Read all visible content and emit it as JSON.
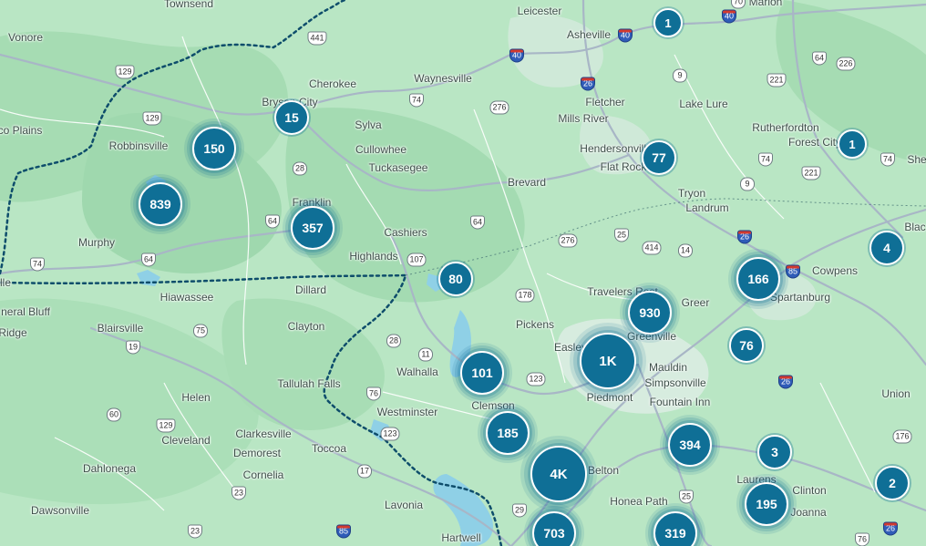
{
  "colors": {
    "land": "#b9e6c4",
    "forest": "#a3dcb2",
    "water": "#8fd0e6",
    "road_major": "#9aa7b5",
    "road_minor": "#ffffff",
    "state_border": "#0e4d6b",
    "cluster": "#0f6f96"
  },
  "places": [
    {
      "id": "townsend",
      "name": "Townsend"
    },
    {
      "id": "vonore",
      "name": "Vonore"
    },
    {
      "id": "leicester",
      "name": "Leicester"
    },
    {
      "id": "asheville",
      "name": "Asheville"
    },
    {
      "id": "marion",
      "name": "Marion"
    },
    {
      "id": "cherokee",
      "name": "Cherokee"
    },
    {
      "id": "waynesville",
      "name": "Waynesville"
    },
    {
      "id": "tellico-plains",
      "name": "co Plains"
    },
    {
      "id": "bryson-city",
      "name": "Bryson City"
    },
    {
      "id": "sylva",
      "name": "Sylva"
    },
    {
      "id": "fletcher",
      "name": "Fletcher"
    },
    {
      "id": "mills-river",
      "name": "Mills River"
    },
    {
      "id": "lake-lure",
      "name": "Lake Lure"
    },
    {
      "id": "rutherfordton",
      "name": "Rutherfordton"
    },
    {
      "id": "robbinsville",
      "name": "Robbinsville"
    },
    {
      "id": "cullowhee",
      "name": "Cullowhee"
    },
    {
      "id": "tuckasegee",
      "name": "Tuckasegee"
    },
    {
      "id": "hendersonville",
      "name": "Hendersonville"
    },
    {
      "id": "flat-rock",
      "name": "Flat Rock"
    },
    {
      "id": "forest-city",
      "name": "Forest City"
    },
    {
      "id": "shelby",
      "name": "She"
    },
    {
      "id": "brevard",
      "name": "Brevard"
    },
    {
      "id": "tryon",
      "name": "Tryon"
    },
    {
      "id": "landrum",
      "name": "Landrum"
    },
    {
      "id": "franklin",
      "name": "Franklin"
    },
    {
      "id": "cashiers",
      "name": "Cashiers"
    },
    {
      "id": "murphy",
      "name": "Murphy"
    },
    {
      "id": "highlands",
      "name": "Highlands"
    },
    {
      "id": "blacksburg",
      "name": "Blac"
    },
    {
      "id": "cowpens",
      "name": "Cowpens"
    },
    {
      "id": "ville",
      "name": "lle"
    },
    {
      "id": "hiawassee",
      "name": "Hiawassee"
    },
    {
      "id": "dillard",
      "name": "Dillard"
    },
    {
      "id": "travelers-rest",
      "name": "Travelers Rest"
    },
    {
      "id": "greer",
      "name": "Greer"
    },
    {
      "id": "spartanburg",
      "name": "Spartanburg"
    },
    {
      "id": "neral-bluff",
      "name": "neral Bluff"
    },
    {
      "id": "blairsville",
      "name": "Blairsville"
    },
    {
      "id": "clayton",
      "name": "Clayton"
    },
    {
      "id": "pickens",
      "name": "Pickens"
    },
    {
      "id": "ridge",
      "name": "Ridge"
    },
    {
      "id": "easley",
      "name": "Easley"
    },
    {
      "id": "greenville",
      "name": "Greenville"
    },
    {
      "id": "walhalla",
      "name": "Walhalla"
    },
    {
      "id": "mauldin",
      "name": "Mauldin"
    },
    {
      "id": "tallulah-falls",
      "name": "Tallulah Falls"
    },
    {
      "id": "simpsonville",
      "name": "Simpsonville"
    },
    {
      "id": "helen",
      "name": "Helen"
    },
    {
      "id": "clemson",
      "name": "Clemson"
    },
    {
      "id": "piedmont",
      "name": "Piedmont"
    },
    {
      "id": "fountain-inn",
      "name": "Fountain Inn"
    },
    {
      "id": "union",
      "name": "Union"
    },
    {
      "id": "westminster",
      "name": "Westminster"
    },
    {
      "id": "clarkesville",
      "name": "Clarkesville"
    },
    {
      "id": "cleveland",
      "name": "Cleveland"
    },
    {
      "id": "demorest",
      "name": "Demorest"
    },
    {
      "id": "toccoa",
      "name": "Toccoa"
    },
    {
      "id": "dahlonega",
      "name": "Dahlonega"
    },
    {
      "id": "cornelia",
      "name": "Cornelia"
    },
    {
      "id": "belton",
      "name": "Belton"
    },
    {
      "id": "laurens",
      "name": "Laurens"
    },
    {
      "id": "clinton",
      "name": "Clinton"
    },
    {
      "id": "honea-path",
      "name": "Honea Path"
    },
    {
      "id": "lavonia",
      "name": "Lavonia"
    },
    {
      "id": "dawsonville",
      "name": "Dawsonville"
    },
    {
      "id": "joanna",
      "name": "Joanna"
    },
    {
      "id": "hartwell",
      "name": "Hartwell"
    }
  ],
  "route_shields": [
    {
      "id": "us441",
      "label": "441",
      "kind": "us"
    },
    {
      "id": "i40-a",
      "label": "40",
      "kind": "interstate"
    },
    {
      "id": "i40-b",
      "label": "40",
      "kind": "interstate"
    },
    {
      "id": "i40-c",
      "label": "40",
      "kind": "interstate"
    },
    {
      "id": "sr70",
      "label": "70",
      "kind": "state"
    },
    {
      "id": "us129-a",
      "label": "129",
      "kind": "us"
    },
    {
      "id": "sr9-a",
      "label": "9",
      "kind": "state"
    },
    {
      "id": "us64-a",
      "label": "64",
      "kind": "us"
    },
    {
      "id": "sr226",
      "label": "226",
      "kind": "state"
    },
    {
      "id": "us74-a",
      "label": "74",
      "kind": "us"
    },
    {
      "id": "i26-a",
      "label": "26",
      "kind": "interstate"
    },
    {
      "id": "sr276-a",
      "label": "276",
      "kind": "state"
    },
    {
      "id": "us221-a",
      "label": "221",
      "kind": "us"
    },
    {
      "id": "us129-b",
      "label": "129",
      "kind": "us"
    },
    {
      "id": "sr28-a",
      "label": "28",
      "kind": "state"
    },
    {
      "id": "us74-b",
      "label": "74",
      "kind": "us"
    },
    {
      "id": "us74-c",
      "label": "74",
      "kind": "us"
    },
    {
      "id": "us221-b",
      "label": "221",
      "kind": "us"
    },
    {
      "id": "sr9-b",
      "label": "9",
      "kind": "state"
    },
    {
      "id": "us64-b",
      "label": "64",
      "kind": "us"
    },
    {
      "id": "us64-c",
      "label": "64",
      "kind": "us"
    },
    {
      "id": "sr276-b",
      "label": "276",
      "kind": "state"
    },
    {
      "id": "us25",
      "label": "25",
      "kind": "us"
    },
    {
      "id": "sr414",
      "label": "414",
      "kind": "state"
    },
    {
      "id": "sr14",
      "label": "14",
      "kind": "state"
    },
    {
      "id": "i26-b",
      "label": "26",
      "kind": "interstate"
    },
    {
      "id": "sr107",
      "label": "107",
      "kind": "state"
    },
    {
      "id": "us74-d",
      "label": "74",
      "kind": "us"
    },
    {
      "id": "us64-d",
      "label": "64",
      "kind": "us"
    },
    {
      "id": "i85-a",
      "label": "85",
      "kind": "interstate"
    },
    {
      "id": "sr178",
      "label": "178",
      "kind": "state"
    },
    {
      "id": "sr75",
      "label": "75",
      "kind": "state"
    },
    {
      "id": "sr19",
      "label": "19",
      "kind": "us"
    },
    {
      "id": "sr28-b",
      "label": "28",
      "kind": "state"
    },
    {
      "id": "sr11",
      "label": "11",
      "kind": "state"
    },
    {
      "id": "sr123-a",
      "label": "123",
      "kind": "state"
    },
    {
      "id": "i26-c",
      "label": "26",
      "kind": "interstate"
    },
    {
      "id": "sr76",
      "label": "76",
      "kind": "us"
    },
    {
      "id": "sr60",
      "label": "60",
      "kind": "state"
    },
    {
      "id": "us129-c",
      "label": "129",
      "kind": "us"
    },
    {
      "id": "sr123-b",
      "label": "123",
      "kind": "state"
    },
    {
      "id": "sr176",
      "label": "176",
      "kind": "state"
    },
    {
      "id": "sr17",
      "label": "17",
      "kind": "state"
    },
    {
      "id": "us23",
      "label": "23",
      "kind": "us"
    },
    {
      "id": "us25-b",
      "label": "25",
      "kind": "us"
    },
    {
      "id": "us23-b",
      "label": "23",
      "kind": "us"
    },
    {
      "id": "i85-b",
      "label": "85",
      "kind": "interstate"
    },
    {
      "id": "sr29",
      "label": "29",
      "kind": "us"
    },
    {
      "id": "sr76-b",
      "label": "76",
      "kind": "us"
    },
    {
      "id": "i26-d",
      "label": "26",
      "kind": "interstate"
    }
  ],
  "clusters": [
    {
      "id": "c1a",
      "count": "1",
      "size": "xs"
    },
    {
      "id": "c15",
      "count": "15",
      "size": "s"
    },
    {
      "id": "c150",
      "count": "150",
      "size": "m"
    },
    {
      "id": "c77",
      "count": "77",
      "size": "s"
    },
    {
      "id": "c1b",
      "count": "1",
      "size": "xs"
    },
    {
      "id": "c839",
      "count": "839",
      "size": "m"
    },
    {
      "id": "c357",
      "count": "357",
      "size": "m"
    },
    {
      "id": "c4",
      "count": "4",
      "size": "s"
    },
    {
      "id": "c80",
      "count": "80",
      "size": "s"
    },
    {
      "id": "c166",
      "count": "166",
      "size": "m"
    },
    {
      "id": "c930",
      "count": "930",
      "size": "m"
    },
    {
      "id": "c76",
      "count": "76",
      "size": "s"
    },
    {
      "id": "c1k",
      "count": "1K",
      "size": "l"
    },
    {
      "id": "c101",
      "count": "101",
      "size": "m"
    },
    {
      "id": "c185",
      "count": "185",
      "size": "m"
    },
    {
      "id": "c394",
      "count": "394",
      "size": "m"
    },
    {
      "id": "c3",
      "count": "3",
      "size": "s"
    },
    {
      "id": "c4k",
      "count": "4K",
      "size": "l"
    },
    {
      "id": "c2",
      "count": "2",
      "size": "s"
    },
    {
      "id": "c195",
      "count": "195",
      "size": "m"
    },
    {
      "id": "c703",
      "count": "703",
      "size": "m"
    },
    {
      "id": "c319",
      "count": "319",
      "size": "m"
    }
  ]
}
